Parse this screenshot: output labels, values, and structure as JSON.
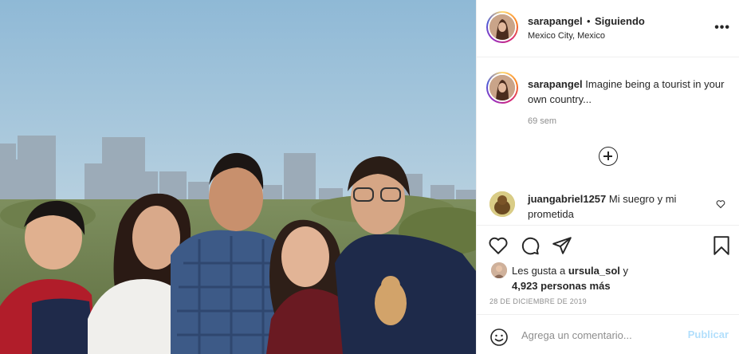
{
  "post": {
    "image_alt": "Family photo with Mexico City skyline",
    "username": "sarapangel",
    "follow_separator": "•",
    "follow_status": "Siguiendo",
    "location": "Mexico City, Mexico",
    "more_icon": "more-horizontal-icon",
    "caption": {
      "username": "sarapangel",
      "text": "Imagine being a tourist in your own country...",
      "time": "69 sem"
    },
    "load_more_icon": "plus-circle-icon",
    "comments": [
      {
        "username": "juangabriel1257",
        "text": "Mi suegro y mi prometida",
        "like_icon": "heart-outline-icon"
      }
    ],
    "actions": {
      "like_icon": "heart-outline-icon",
      "comment_icon": "comment-icon",
      "share_icon": "paper-plane-icon",
      "save_icon": "bookmark-icon"
    },
    "likes": {
      "prefix": "Les gusta a",
      "liker": "ursula_sol",
      "conjunction": "y",
      "others": "4,923 personas más"
    },
    "date": "28 DE DICIEMBRE DE 2019",
    "add_comment": {
      "emoji_icon": "smiley-icon",
      "placeholder": "Agrega un comentario...",
      "publish_label": "Publicar"
    }
  },
  "colors": {
    "border": "#efefef",
    "text": "#262626",
    "secondary": "#8e8e8e",
    "publish_disabled": "#b2dffc"
  }
}
